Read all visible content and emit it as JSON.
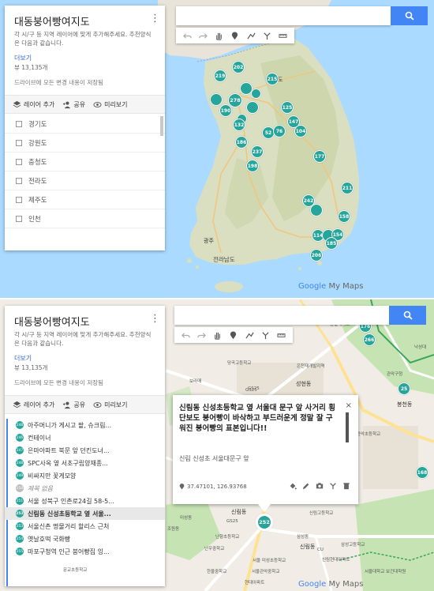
{
  "map_title": "대동붕어빵여지도",
  "description": "각 시/구 등 지역 레이어에 맞게 추가해주세요. 추천양식은 다음과 같습니다.",
  "more_link": "더보기",
  "views": "뷰 13,135개",
  "saved_status": "드라이브에 모든 변경 내용이 저장됨",
  "toolbar": {
    "add_layer": "레이어 추가",
    "share": "공유",
    "preview": "미리보기"
  },
  "layers": [
    "경기도",
    "강원도",
    "충청도",
    "전라도",
    "제주도",
    "인천"
  ],
  "items": [
    {
      "num": "248",
      "label": "아주머니가 게시고 팥, 슈크림..."
    },
    {
      "num": "246",
      "label": "컨테이너"
    },
    {
      "num": "247",
      "label": "은마아파트 북문 앞 던킨도너..."
    },
    {
      "num": "248",
      "label": "SPC사옥 옆 서초구립양재종..."
    },
    {
      "num": "249",
      "label": "비싸지만 꽃게모양"
    },
    {
      "num": "250",
      "label": "제목 없음"
    },
    {
      "num": "251",
      "label": "서울 성북구 인촌로24길 58-5..."
    },
    {
      "num": "252",
      "label": "신림동 신성초등학교 옆 서울..."
    },
    {
      "num": "253",
      "label": "서울신촌 명물거리 할리스 근처"
    },
    {
      "num": "254",
      "label": "옛날호떡 국화빵"
    },
    {
      "num": "255",
      "label": "마포구청역 인근 붕어빵집 잉..."
    }
  ],
  "markers_top": [
    "219",
    "202",
    "215",
    "278",
    "190",
    "125",
    "147",
    "52",
    "76",
    "104",
    "186",
    "237",
    "198",
    "177",
    "211",
    "242",
    "158",
    "114",
    "154",
    "185",
    "206",
    "132"
  ],
  "markers_bottom": [
    "176",
    "266",
    "25",
    "168",
    "252"
  ],
  "places_top": {
    "gangwon": "강원도",
    "kwangju": "광주",
    "jeonnam": "전라남도",
    "gwangju_city": "광주"
  },
  "places_bottom": [
    "숭실대학교",
    "낙성대",
    "당곡고등학교",
    "은천재개발지역",
    "성현동",
    "보라매",
    "GS25",
    "관악구청",
    "봉천동",
    "서울 관악초등학교",
    "신림동",
    "GS25",
    "미성동",
    "난향초등학교",
    "신림고등학교",
    "조원동",
    "삼성동",
    "신림동",
    "난우중학교",
    "신림현대아파트",
    "서울 미성초등학교",
    "한울중학교",
    "서울관악중학교",
    "문교초등학교",
    "서울대학교 보건대학원",
    "현대아파트",
    "삼성고등학교",
    "GS25",
    "CU"
  ],
  "popup": {
    "title": "신림동 신성초등학교 옆 서울대 문구 앞 사거리 횡단보도 붕어빵이 바삭하고 부드러운게 정말 잘 구워진 붕어빵의 표본입니다!!",
    "address": "신림 신성초 서울대문구 앞",
    "coords": "37.47101, 126.93768",
    "close": "×"
  },
  "logo": {
    "google": "Google",
    "mymaps": "My Maps"
  },
  "colors": {
    "marker": "#26a69a",
    "search_button": "#4285f4",
    "link": "#3367d6"
  }
}
